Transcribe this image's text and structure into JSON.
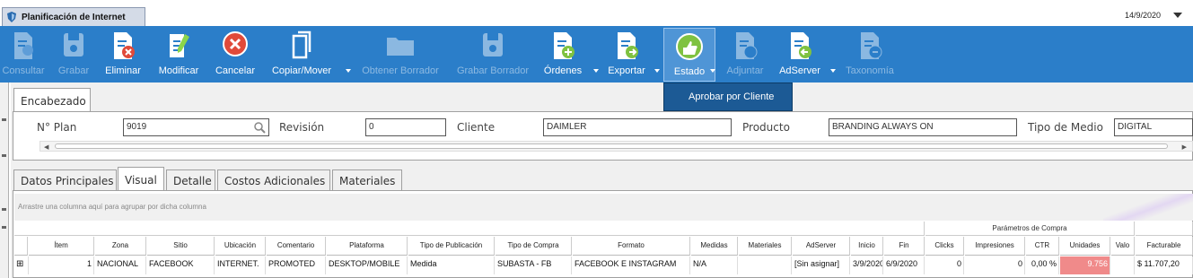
{
  "window": {
    "title": "Planificación de Internet",
    "date": "14/9/2020"
  },
  "toolbar": {
    "items": [
      {
        "label": "Consultar",
        "icon": "search-doc-icon"
      },
      {
        "label": "Grabar",
        "icon": "save-icon"
      },
      {
        "label": "Eliminar",
        "icon": "delete-doc-icon"
      },
      {
        "label": "Modificar",
        "icon": "edit-icon"
      },
      {
        "label": "Cancelar",
        "icon": "cancel-icon"
      },
      {
        "label": "Copiar/Mover",
        "icon": "copy-icon"
      },
      {
        "label": "Obtener Borrador",
        "icon": "folder-icon"
      },
      {
        "label": "Grabar Borrador",
        "icon": "save-draft-icon"
      },
      {
        "label": "Órdenes",
        "icon": "orders-icon"
      },
      {
        "label": "Exportar",
        "icon": "export-icon"
      },
      {
        "label": "Estado",
        "icon": "thumbs-up-icon"
      },
      {
        "label": "Adjuntar",
        "icon": "attach-icon"
      },
      {
        "label": "AdServer",
        "icon": "adserver-icon"
      },
      {
        "label": "Taxonomía",
        "icon": "taxonomy-icon"
      }
    ],
    "colors": {
      "bar": "#2b7ec9",
      "active": "#4f95d6",
      "menu": "#1c5a95"
    }
  },
  "estado_menu": {
    "items": [
      "Aprobar por Cliente"
    ]
  },
  "header_tab": "Encabezado",
  "header": {
    "plan_label": "N° Plan",
    "plan_value": "9019",
    "revision_label": "Revisión",
    "revision_value": "0",
    "cliente_label": "Cliente",
    "cliente_value": "DAIMLER",
    "producto_label": "Producto",
    "producto_value": "BRANDING ALWAYS ON",
    "tipo_medio_label": "Tipo de Medio",
    "tipo_medio_value": "DIGITAL"
  },
  "tabs": [
    "Datos Principales",
    "Visual",
    "Detalle",
    "Costos Adicionales",
    "Materiales"
  ],
  "selected_tab": "Visual",
  "grid": {
    "group_hint": "Arrastre una columna aquí para agrupar por dicha columna",
    "group_header": "Parámetros de Compra",
    "columns": [
      "Ítem",
      "Zona",
      "Sitio",
      "Ubicación",
      "Comentario",
      "Plataforma",
      "Tipo de Publicación",
      "Tipo de Compra",
      "Formato",
      "Medidas",
      "Materiales",
      "AdServer",
      "Inicio",
      "Fin",
      "Clicks",
      "Impresiones",
      "CTR",
      "Unidades",
      "Valo",
      "Facturable"
    ],
    "rows": [
      {
        "expand": "⊞",
        "values": [
          "1",
          "NACIONAL",
          "FACEBOOK",
          "INTERNET.",
          "PROMOTED",
          "DESKTOP/MOBILE",
          "Medida",
          "SUBASTA - FB",
          "FACEBOOK E INSTAGRAM",
          "N/A",
          "",
          "[Sin asignar]",
          "3/9/2020",
          "6/9/2020",
          "0",
          "0",
          "0,00 %",
          "9.756",
          "",
          "$ 11.707,20"
        ]
      }
    ],
    "highlight_color": "#f08a8a"
  }
}
